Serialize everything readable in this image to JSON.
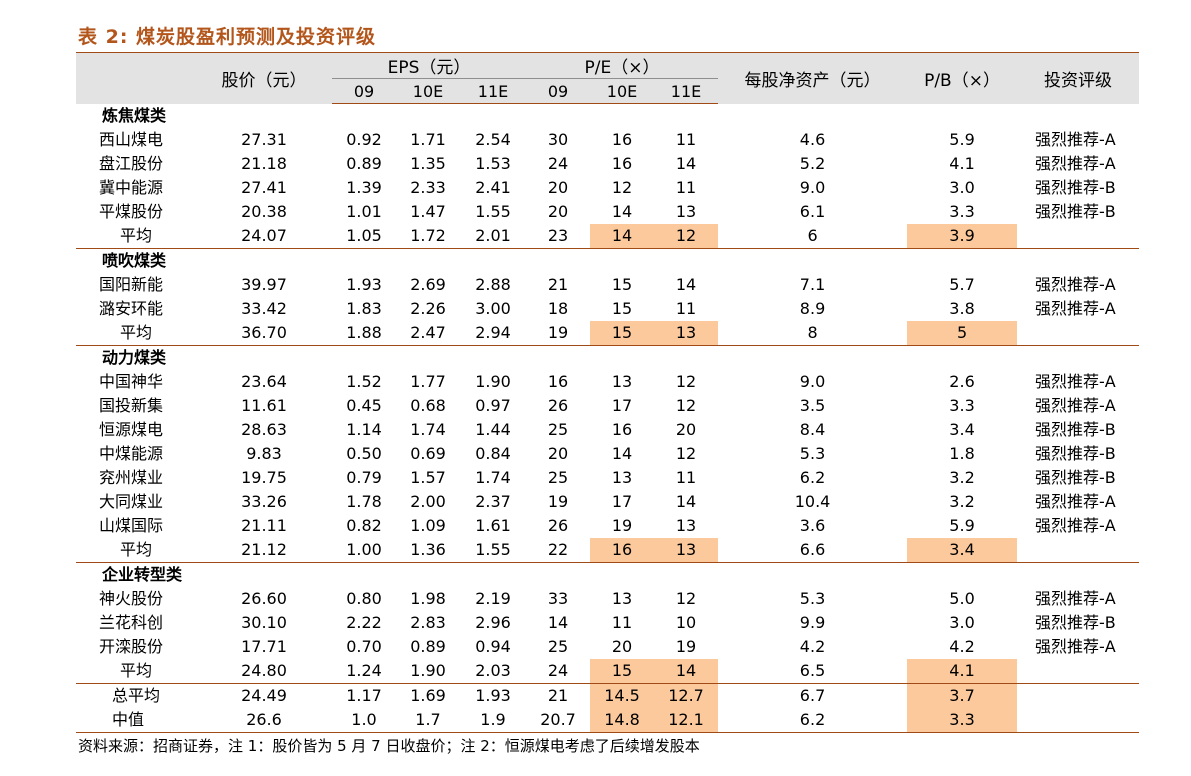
{
  "title": "表 2:  煤炭股盈利预测及投资评级",
  "header": {
    "price": "股价（元）",
    "eps": "EPS（元）",
    "pe": "P/E（×）",
    "bvps": "每股净资产（元）",
    "pb": "P/B（×）",
    "rating": "投资评级",
    "years": [
      "09",
      "10E",
      "11E"
    ]
  },
  "sections": [
    {
      "name": "炼焦煤类",
      "rows": [
        {
          "name": "西山煤电",
          "price": "27.31",
          "eps": [
            "0.92",
            "1.71",
            "2.54"
          ],
          "pe": [
            "30",
            "16",
            "11"
          ],
          "bvps": "4.6",
          "pb": "5.9",
          "rating": "强烈推荐-A"
        },
        {
          "name": "盘江股份",
          "price": "21.18",
          "eps": [
            "0.89",
            "1.35",
            "1.53"
          ],
          "pe": [
            "24",
            "16",
            "14"
          ],
          "bvps": "5.2",
          "pb": "4.1",
          "rating": "强烈推荐-A"
        },
        {
          "name": "冀中能源",
          "price": "27.41",
          "eps": [
            "1.39",
            "2.33",
            "2.41"
          ],
          "pe": [
            "20",
            "12",
            "11"
          ],
          "bvps": "9.0",
          "pb": "3.0",
          "rating": "强烈推荐-B"
        },
        {
          "name": "平煤股份",
          "price": "20.38",
          "eps": [
            "1.01",
            "1.47",
            "1.55"
          ],
          "pe": [
            "20",
            "14",
            "13"
          ],
          "bvps": "6.1",
          "pb": "3.3",
          "rating": "强烈推荐-B"
        }
      ],
      "avg": {
        "name": "平均",
        "price": "24.07",
        "eps": [
          "1.05",
          "1.72",
          "2.01"
        ],
        "pe": [
          "23",
          "14",
          "12"
        ],
        "bvps": "6",
        "pb": "3.9",
        "rating": ""
      }
    },
    {
      "name": "喷吹煤类",
      "rows": [
        {
          "name": "国阳新能",
          "price": "39.97",
          "eps": [
            "1.93",
            "2.69",
            "2.88"
          ],
          "pe": [
            "21",
            "15",
            "14"
          ],
          "bvps": "7.1",
          "pb": "5.7",
          "rating": "强烈推荐-A"
        },
        {
          "name": "潞安环能",
          "price": "33.42",
          "eps": [
            "1.83",
            "2.26",
            "3.00"
          ],
          "pe": [
            "18",
            "15",
            "11"
          ],
          "bvps": "8.9",
          "pb": "3.8",
          "rating": "强烈推荐-A"
        }
      ],
      "avg": {
        "name": "平均",
        "price": "36.70",
        "eps": [
          "1.88",
          "2.47",
          "2.94"
        ],
        "pe": [
          "19",
          "15",
          "13"
        ],
        "bvps": "8",
        "pb": "5",
        "rating": ""
      }
    },
    {
      "name": "动力煤类",
      "rows": [
        {
          "name": "中国神华",
          "price": "23.64",
          "eps": [
            "1.52",
            "1.77",
            "1.90"
          ],
          "pe": [
            "16",
            "13",
            "12"
          ],
          "bvps": "9.0",
          "pb": "2.6",
          "rating": "强烈推荐-A"
        },
        {
          "name": "国投新集",
          "price": "11.61",
          "eps": [
            "0.45",
            "0.68",
            "0.97"
          ],
          "pe": [
            "26",
            "17",
            "12"
          ],
          "bvps": "3.5",
          "pb": "3.3",
          "rating": "强烈推荐-A"
        },
        {
          "name": "恒源煤电",
          "price": "28.63",
          "eps": [
            "1.14",
            "1.74",
            "1.44"
          ],
          "pe": [
            "25",
            "16",
            "20"
          ],
          "bvps": "8.4",
          "pb": "3.4",
          "rating": "强烈推荐-B"
        },
        {
          "name": "中煤能源",
          "price": "9.83",
          "eps": [
            "0.50",
            "0.69",
            "0.84"
          ],
          "pe": [
            "20",
            "14",
            "12"
          ],
          "bvps": "5.3",
          "pb": "1.8",
          "rating": "强烈推荐-B"
        },
        {
          "name": "兖州煤业",
          "price": "19.75",
          "eps": [
            "0.79",
            "1.57",
            "1.74"
          ],
          "pe": [
            "25",
            "13",
            "11"
          ],
          "bvps": "6.2",
          "pb": "3.2",
          "rating": "强烈推荐-B"
        },
        {
          "name": "大同煤业",
          "price": "33.26",
          "eps": [
            "1.78",
            "2.00",
            "2.37"
          ],
          "pe": [
            "19",
            "17",
            "14"
          ],
          "bvps": "10.4",
          "pb": "3.2",
          "rating": "强烈推荐-A"
        },
        {
          "name": "山煤国际",
          "price": "21.11",
          "eps": [
            "0.82",
            "1.09",
            "1.61"
          ],
          "pe": [
            "26",
            "19",
            "13"
          ],
          "bvps": "3.6",
          "pb": "5.9",
          "rating": "强烈推荐-A"
        }
      ],
      "avg": {
        "name": "平均",
        "price": "21.12",
        "eps": [
          "1.00",
          "1.36",
          "1.55"
        ],
        "pe": [
          "22",
          "16",
          "13"
        ],
        "bvps": "6.6",
        "pb": "3.4",
        "rating": ""
      }
    },
    {
      "name": "企业转型类",
      "rows": [
        {
          "name": "神火股份",
          "price": "26.60",
          "eps": [
            "0.80",
            "1.98",
            "2.19"
          ],
          "pe": [
            "33",
            "13",
            "12"
          ],
          "bvps": "5.3",
          "pb": "5.0",
          "rating": "强烈推荐-A"
        },
        {
          "name": "兰花科创",
          "price": "30.10",
          "eps": [
            "2.22",
            "2.83",
            "2.96"
          ],
          "pe": [
            "14",
            "11",
            "10"
          ],
          "bvps": "9.9",
          "pb": "3.0",
          "rating": "强烈推荐-B"
        },
        {
          "name": "开滦股份",
          "price": "17.71",
          "eps": [
            "0.70",
            "0.89",
            "0.94"
          ],
          "pe": [
            "25",
            "20",
            "19"
          ],
          "bvps": "4.2",
          "pb": "4.2",
          "rating": "强烈推荐-A"
        }
      ],
      "avg": {
        "name": "平均",
        "price": "24.80",
        "eps": [
          "1.24",
          "1.90",
          "2.03"
        ],
        "pe": [
          "24",
          "15",
          "14"
        ],
        "bvps": "6.5",
        "pb": "4.1",
        "rating": ""
      }
    }
  ],
  "totals": [
    {
      "name": "总平均",
      "price": "24.49",
      "eps": [
        "1.17",
        "1.69",
        "1.93"
      ],
      "pe": [
        "21",
        "14.5",
        "12.7"
      ],
      "bvps": "6.7",
      "pb": "3.7",
      "rating": ""
    },
    {
      "name": "中值",
      "price": "26.6",
      "eps": [
        "1.0",
        "1.7",
        "1.9"
      ],
      "pe": [
        "20.7",
        "14.8",
        "12.1"
      ],
      "bvps": "6.2",
      "pb": "3.3",
      "rating": ""
    }
  ],
  "source": "资料来源：招商证券，注 1：股价皆为 5 月 7 日收盘价；注 2：恒源煤电考虑了后续增发股本"
}
